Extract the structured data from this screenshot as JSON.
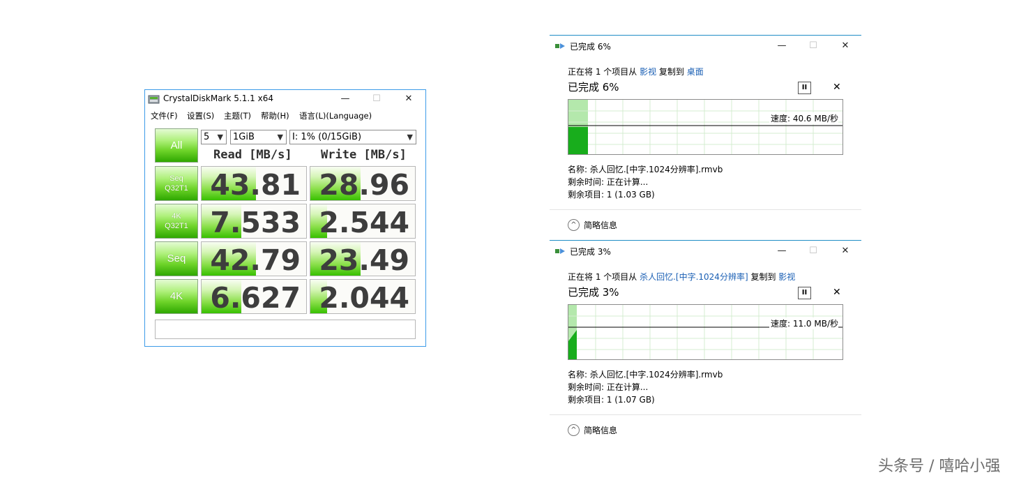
{
  "cdm": {
    "title": "CrystalDiskMark 5.1.1 x64",
    "window_controls": {
      "minimize": "—",
      "maximize": "☐",
      "close": "✕"
    },
    "menu": [
      "文件(F)",
      "设置(S)",
      "主题(T)",
      "帮助(H)",
      "语言(L)(Language)"
    ],
    "all_label": "All",
    "count_select": "5",
    "size_select": "1GiB",
    "drive_select": "I: 1% (0/15GiB)",
    "read_header": "Read [MB/s]",
    "write_header": "Write [MB/s]",
    "rows": [
      {
        "label1": "Seq",
        "label2": "Q32T1",
        "read": "43.81",
        "write": "28.96",
        "read_fill": 0.52,
        "write_fill": 0.48
      },
      {
        "label1": "4K",
        "label2": "Q32T1",
        "read": "7.533",
        "write": "2.544",
        "read_fill": 0.38,
        "write_fill": 0.16
      },
      {
        "label1": "Seq",
        "label2": "",
        "read": "42.79",
        "write": "23.49",
        "read_fill": 0.52,
        "write_fill": 0.48
      },
      {
        "label1": "4K",
        "label2": "",
        "read": "6.627",
        "write": "2.044",
        "read_fill": 0.38,
        "write_fill": 0.16
      }
    ],
    "comment": ""
  },
  "dialogs": [
    {
      "title": "已完成 6%",
      "line_prefix": "正在将 1 个项目从 ",
      "source": "影视",
      "line_mid": " 复制到 ",
      "dest": "桌面",
      "percent_text": "已完成 6%",
      "progress": 0.06,
      "speed": "速度: 40.6 MB/秒",
      "name": "名称: 杀人回忆.[中字.1024分辨率].rmvb",
      "time_left": "剩余时间: 正在计算...",
      "items_left": "剩余项目: 1 (1.03 GB)",
      "less_info": "简略信息"
    },
    {
      "title": "已完成 3%",
      "line_prefix": "正在将 1 个项目从 ",
      "source": "杀人回忆.[中字.1024分辨率]",
      "line_mid": " 复制到 ",
      "dest": "影视",
      "percent_text": "已完成 3%",
      "progress": 0.03,
      "speed": "速度: 11.0 MB/秒",
      "name": "名称: 杀人回忆.[中字.1024分辨率].rmvb",
      "time_left": "剩余时间: 正在计算...",
      "items_left": "剩余项目: 1 (1.07 GB)",
      "less_info": "简略信息"
    }
  ],
  "dialog_controls": {
    "minimize": "—",
    "maximize": "☐",
    "close": "✕",
    "pause": "II",
    "cancel": "✕",
    "expand": "^"
  },
  "watermark": "头条号 / 嘻哈小强"
}
